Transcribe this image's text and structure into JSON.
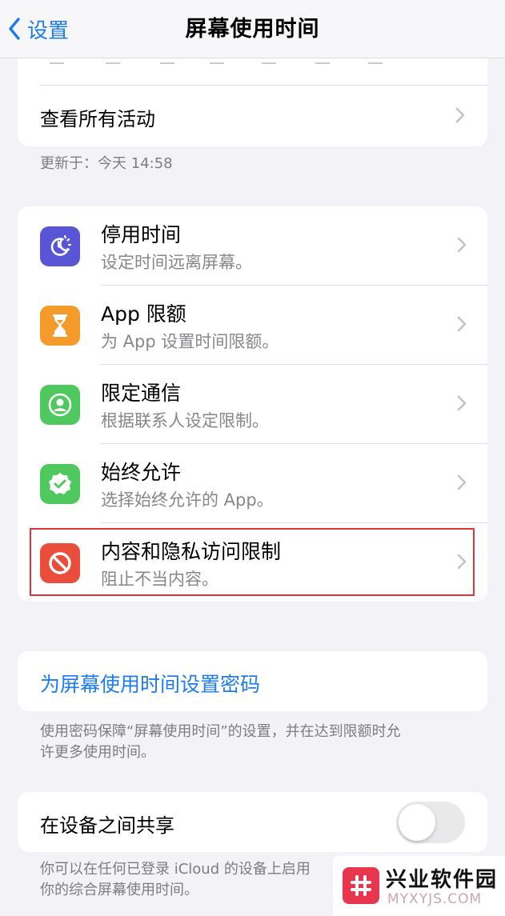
{
  "nav": {
    "back_label": "设置",
    "title": "屏幕使用时间"
  },
  "activity": {
    "see_all_label": "查看所有活动",
    "updated": "更新于：今天 14:58"
  },
  "items": [
    {
      "title": "停用时间",
      "subtitle": "设定时间远离屏幕。",
      "icon": "downtime-icon",
      "color": "#5856d6"
    },
    {
      "title": "App 限额",
      "subtitle": "为 App 设置时间限额。",
      "icon": "hourglass-icon",
      "color": "#f49b2b"
    },
    {
      "title": "限定通信",
      "subtitle": "根据联系人设定限制。",
      "icon": "contact-icon",
      "color": "#4fc95e"
    },
    {
      "title": "始终允许",
      "subtitle": "选择始终允许的 App。",
      "icon": "checkmark-badge-icon",
      "color": "#4fc95e"
    },
    {
      "title": "内容和隐私访问限制",
      "subtitle": "阻止不当内容。",
      "icon": "restriction-icon",
      "color": "#eb4d3d"
    }
  ],
  "passcode": {
    "link_label": "为屏幕使用时间设置密码",
    "note_line1": "使用密码保障“屏幕使用时间”的设置，并在达到限额时允",
    "note_line2": "许更多使用时间。"
  },
  "share": {
    "label": "在设备之间共享",
    "toggle_on": false,
    "note_line1": "你可以在任何已登录 iCloud 的设备上启用",
    "note_line2": "你的综合屏幕使用时间。"
  },
  "watermark": {
    "title": "兴业软件园",
    "url": "MYXYJS.COM"
  },
  "colors": {
    "accent": "#1d7cf2",
    "highlight": "#e0343b"
  }
}
